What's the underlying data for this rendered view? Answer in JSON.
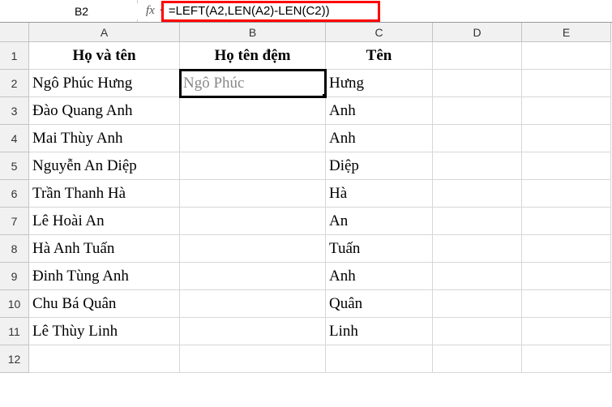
{
  "nameBox": {
    "value": "B2"
  },
  "formulaBar": {
    "fxLabel": "fx",
    "formula": "=LEFT(A2,LEN(A2)-LEN(C2))"
  },
  "columns": [
    "A",
    "B",
    "C",
    "D",
    "E"
  ],
  "rowNumbers": [
    "1",
    "2",
    "3",
    "4",
    "5",
    "6",
    "7",
    "8",
    "9",
    "10",
    "11",
    "12"
  ],
  "headers": {
    "A": "Họ và tên",
    "B": "Họ tên đệm",
    "C": "Tên"
  },
  "rows": [
    {
      "A": "Ngô Phúc Hưng",
      "B": "Ngô Phúc",
      "C": "Hưng"
    },
    {
      "A": "Đào Quang Anh",
      "B": "",
      "C": "Anh"
    },
    {
      "A": "Mai Thùy Anh",
      "B": "",
      "C": "Anh"
    },
    {
      "A": "Nguyễn An Diệp",
      "B": "",
      "C": "Diệp"
    },
    {
      "A": "Trần Thanh Hà",
      "B": "",
      "C": "Hà"
    },
    {
      "A": "Lê Hoài An",
      "B": "",
      "C": "An"
    },
    {
      "A": "Hà Anh Tuấn",
      "B": "",
      "C": "Tuấn"
    },
    {
      "A": "Đinh Tùng Anh",
      "B": "",
      "C": "Anh"
    },
    {
      "A": "Chu Bá Quân",
      "B": "",
      "C": "Quân"
    },
    {
      "A": "Lê Thùy Linh",
      "B": "",
      "C": "Linh"
    }
  ],
  "selectedCell": "B2"
}
